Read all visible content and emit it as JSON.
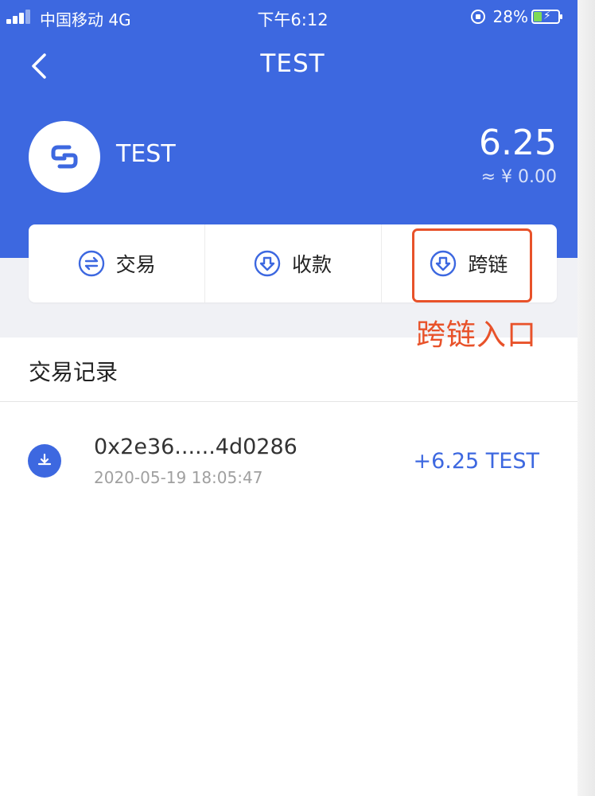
{
  "status_bar": {
    "carrier": "中国移动 4G",
    "time": "下午6:12",
    "battery": "28%"
  },
  "nav": {
    "title": "TEST"
  },
  "token": {
    "name": "TEST",
    "balance": "6.25",
    "fiat_value": "≈ ¥ 0.00"
  },
  "actions": [
    {
      "label": "交易",
      "icon": "swap-circle-icon"
    },
    {
      "label": "收款",
      "icon": "receive-circle-icon"
    },
    {
      "label": "跨链",
      "icon": "cross-chain-circle-icon"
    }
  ],
  "annotation": {
    "text": "跨链入口",
    "color": "#e8522a"
  },
  "history": {
    "title": "交易记录",
    "transactions": [
      {
        "hash": "0x2e36......4d0286",
        "time": "2020-05-19 18:05:47",
        "amount": "+6.25 TEST",
        "icon": "download-icon"
      }
    ]
  },
  "colors": {
    "brand_blue": "#3d68e0",
    "page_bg": "#f0f1f5"
  }
}
